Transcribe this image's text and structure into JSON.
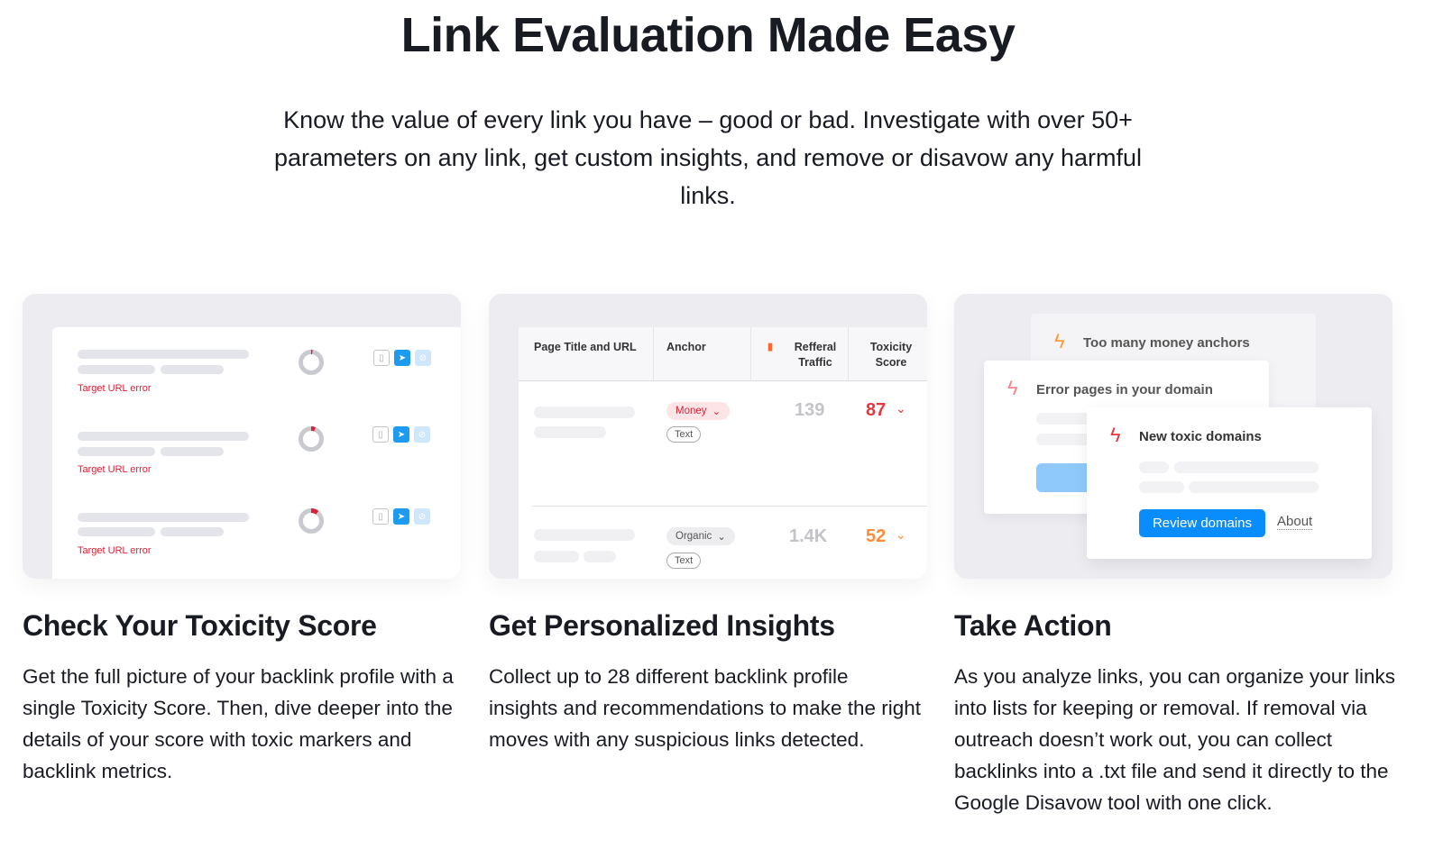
{
  "hero": {
    "title": "Link Evaluation Made Easy",
    "subtitle": "Know the value of every link you have – good or bad. Investigate with over 50+ parameters on any link, get custom insights, and remove or disavow any harmful links."
  },
  "card1": {
    "rows": [
      {
        "error": "Target URL error",
        "toxicity_fraction": 0.02
      },
      {
        "error": "Target URL error",
        "toxicity_fraction": 0.06
      },
      {
        "error": "Target URL error",
        "toxicity_fraction": 0.1
      }
    ],
    "icons": [
      "document-icon",
      "send-icon",
      "block-icon"
    ]
  },
  "card2": {
    "headers": [
      "Page Title and URL",
      "Anchor",
      "Refferal Traffic",
      "Toxicity Score"
    ],
    "rows": [
      {
        "anchor_type": "Money",
        "anchor_tag": "Text",
        "traffic": "139",
        "toxicity": "87"
      },
      {
        "anchor_type": "Organic",
        "anchor_tag": "Text",
        "traffic": "1.4K",
        "toxicity": "52"
      }
    ],
    "colors": {
      "high": "#e8363d",
      "medium": "#ff8c3a"
    }
  },
  "card3": {
    "alerts": [
      "Too many money anchors",
      "Error pages in your domain",
      "New toxic domains"
    ],
    "review_button": "Review domains",
    "about_link": "About",
    "accent": "#0a8dfc"
  },
  "features": [
    {
      "title": "Check Your Toxicity Score",
      "text": "Get the full picture of your backlink profile with a single Toxicity Score. Then, dive deeper into the details of your score with toxic markers and backlink metrics."
    },
    {
      "title": "Get Personalized Insights",
      "text": "Collect up to 28 different backlink profile insights and recommendations to make the right moves with any suspicious links detected."
    },
    {
      "title": "Take Action",
      "text": "As you analyze links, you can organize your links into lists for keeping or removal. If removal via outreach doesn’t work out, you can collect backlinks into a .txt file and send it directly to the Google Disavow tool with one click."
    }
  ]
}
